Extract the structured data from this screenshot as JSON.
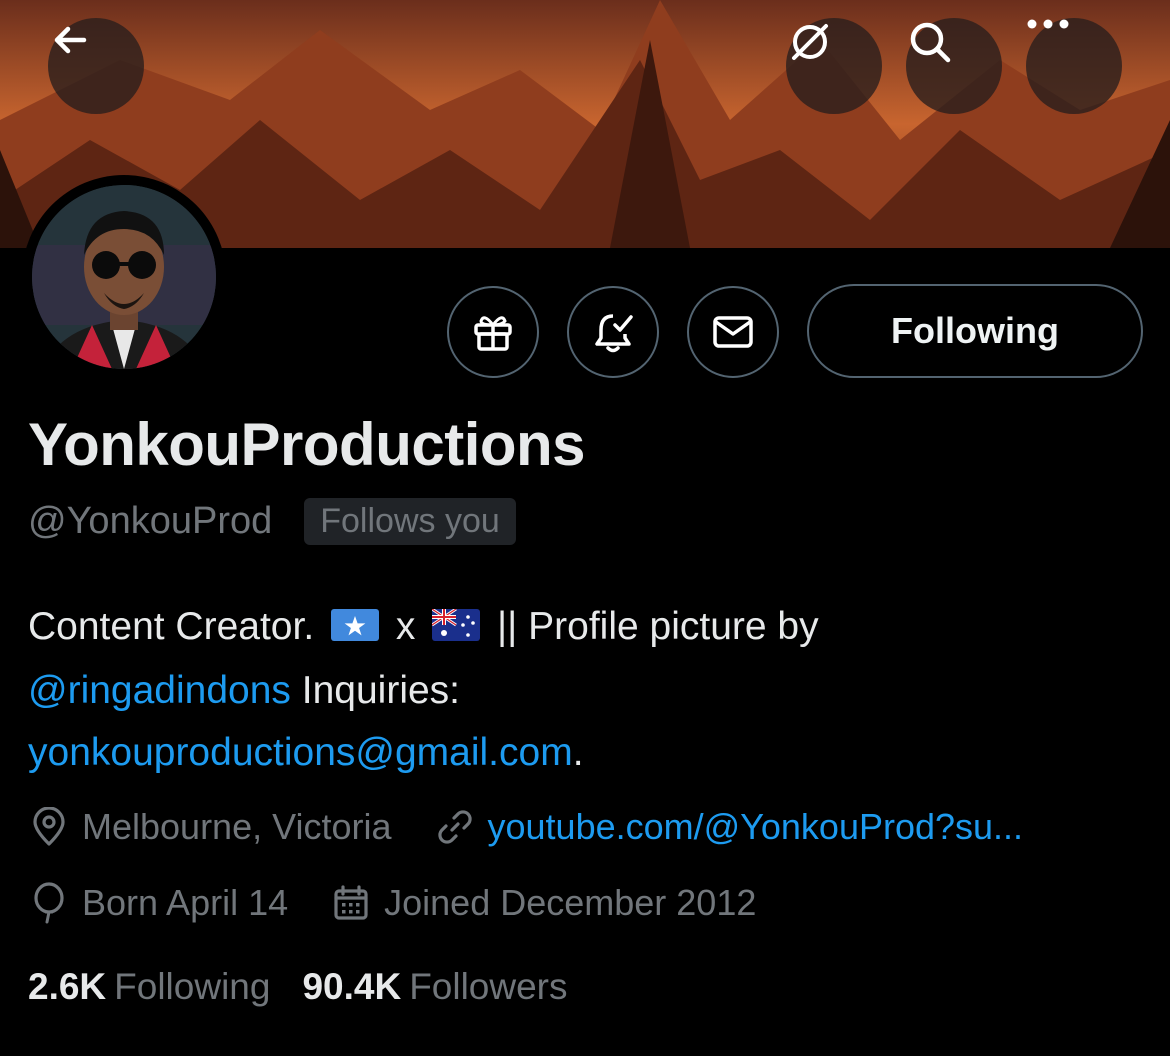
{
  "header": {
    "back_icon": "arrow-left-icon",
    "grok_icon": "slashed-circle-icon",
    "search_icon": "search-icon",
    "more_icon": "more-horizontal-icon"
  },
  "actions": {
    "gift_icon": "gift-icon",
    "notify_icon": "bell-check-icon",
    "message_icon": "envelope-icon",
    "following_label": "Following"
  },
  "profile": {
    "display_name": "YonkouProductions",
    "handle": "@YonkouProd",
    "follows_you": "Follows you",
    "bio": {
      "part1": "Content Creator.",
      "x": "x",
      "part2": "|| Profile picture by",
      "mention": "@ringadindons",
      "part3": " Inquiries:",
      "email": "yonkouproductions@gmail.com",
      "end": "."
    },
    "location": "Melbourne, Victoria",
    "website": "youtube.com/@YonkouProd?su...",
    "birthday": "Born April 14",
    "joined": "Joined December 2012"
  },
  "stats": {
    "following_count": "2.6K",
    "following_label": "Following",
    "followers_count": "90.4K",
    "followers_label": "Followers"
  },
  "colors": {
    "accent": "#1d9bf0",
    "secondary_text": "#71767b",
    "border": "#536471"
  }
}
